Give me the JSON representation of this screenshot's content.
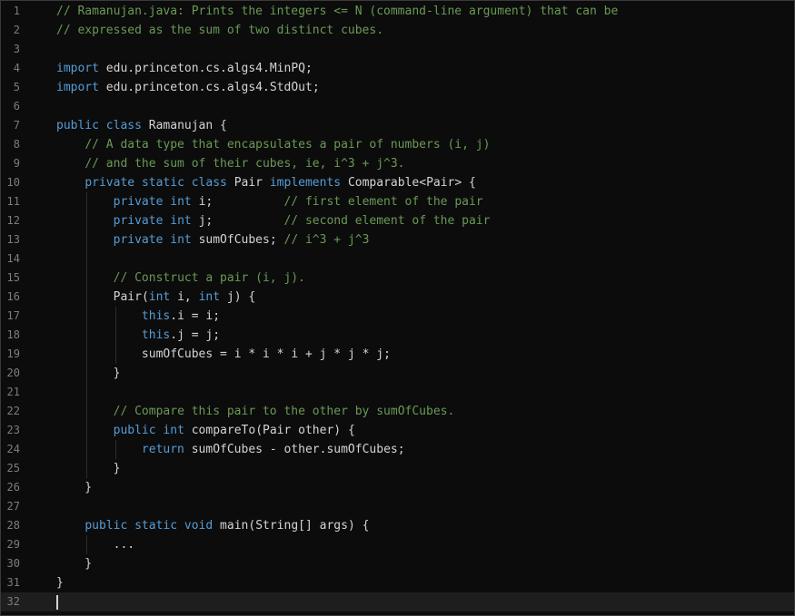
{
  "editor": {
    "language": "java",
    "current_line": 32,
    "colors": {
      "background": "#0c0c0c",
      "current_line": "#1e1e1e",
      "keyword": "#569cd6",
      "comment": "#6a9955",
      "text": "#d4d4d4",
      "line_number": "#7d7d7d"
    },
    "lines": [
      {
        "n": "1",
        "text": "// Ramanujan.java: Prints the integers <= N (command-line argument) that can be"
      },
      {
        "n": "2",
        "text": "// expressed as the sum of two distinct cubes."
      },
      {
        "n": "3",
        "text": ""
      },
      {
        "n": "4",
        "text": "import edu.princeton.cs.algs4.MinPQ;"
      },
      {
        "n": "5",
        "text": "import edu.princeton.cs.algs4.StdOut;"
      },
      {
        "n": "6",
        "text": ""
      },
      {
        "n": "7",
        "text": "public class Ramanujan {"
      },
      {
        "n": "8",
        "text": "    // A data type that encapsulates a pair of numbers (i, j)"
      },
      {
        "n": "9",
        "text": "    // and the sum of their cubes, ie, i^3 + j^3."
      },
      {
        "n": "10",
        "text": "    private static class Pair implements Comparable<Pair> {"
      },
      {
        "n": "11",
        "text": "        private int i;          // first element of the pair"
      },
      {
        "n": "12",
        "text": "        private int j;          // second element of the pair"
      },
      {
        "n": "13",
        "text": "        private int sumOfCubes; // i^3 + j^3"
      },
      {
        "n": "14",
        "text": ""
      },
      {
        "n": "15",
        "text": "        // Construct a pair (i, j)."
      },
      {
        "n": "16",
        "text": "        Pair(int i, int j) {"
      },
      {
        "n": "17",
        "text": "            this.i = i;"
      },
      {
        "n": "18",
        "text": "            this.j = j;"
      },
      {
        "n": "19",
        "text": "            sumOfCubes = i * i * i + j * j * j;"
      },
      {
        "n": "20",
        "text": "        }"
      },
      {
        "n": "21",
        "text": ""
      },
      {
        "n": "22",
        "text": "        // Compare this pair to the other by sumOfCubes."
      },
      {
        "n": "23",
        "text": "        public int compareTo(Pair other) {"
      },
      {
        "n": "24",
        "text": "            return sumOfCubes - other.sumOfCubes;"
      },
      {
        "n": "25",
        "text": "        }"
      },
      {
        "n": "26",
        "text": "    }"
      },
      {
        "n": "27",
        "text": ""
      },
      {
        "n": "28",
        "text": "    public static void main(String[] args) {"
      },
      {
        "n": "29",
        "text": "        ..."
      },
      {
        "n": "30",
        "text": "    }"
      },
      {
        "n": "31",
        "text": "}"
      },
      {
        "n": "32",
        "text": ""
      }
    ]
  }
}
